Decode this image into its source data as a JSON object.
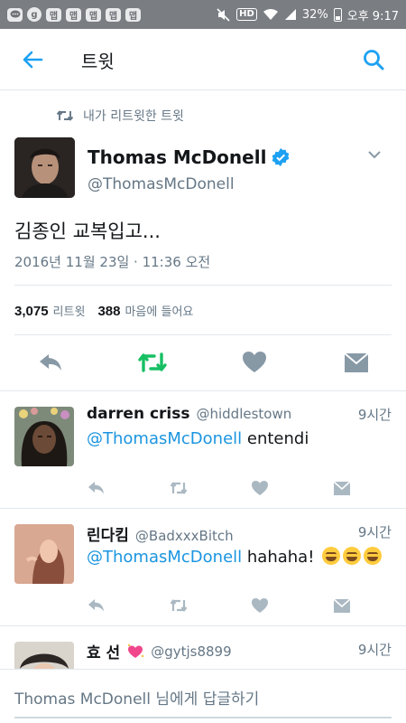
{
  "status_bar": {
    "icons": [
      "chat-bubble-icon",
      "g-icon",
      "app-icon",
      "app-icon",
      "app-icon",
      "app-icon",
      "app-icon"
    ],
    "app_icon_label": "맵",
    "g_label": "g",
    "hd": "HD",
    "battery": "32%",
    "time": "오후 9:17"
  },
  "app_bar": {
    "title": "트윗",
    "accent": "#1da1f2"
  },
  "retweet_context": {
    "label": "내가 리트윗한 트윗"
  },
  "main_tweet": {
    "name": "Thomas McDonell",
    "handle": "@ThomasMcDonell",
    "text": "김종인 교복입고...",
    "timestamp": "2016년 11월 23일 · 11:36 오전",
    "retweet_count": "3,075",
    "retweet_label": "리트윗",
    "like_count": "388",
    "like_label": "마음에 들어요",
    "retweeted": true,
    "retweet_color": "#17bf63"
  },
  "replies": [
    {
      "name": "darren criss",
      "handle": "@hiddlestown",
      "time": "9시간",
      "mention": "@ThomasMcDonell",
      "text": " entendi",
      "emoji_count": 0
    },
    {
      "name": "린다킴",
      "handle": "@BadxxxBitch",
      "time": "9시간",
      "mention": "@ThomasMcDonell",
      "text": " hahaha! ",
      "emoji_count": 3
    },
    {
      "name": "효 선",
      "handle": "@gytjs8899",
      "time": "9시간"
    }
  ],
  "reply_bar": {
    "name": "Thomas McDonell",
    "suffix": " 님에게 답글하기"
  }
}
